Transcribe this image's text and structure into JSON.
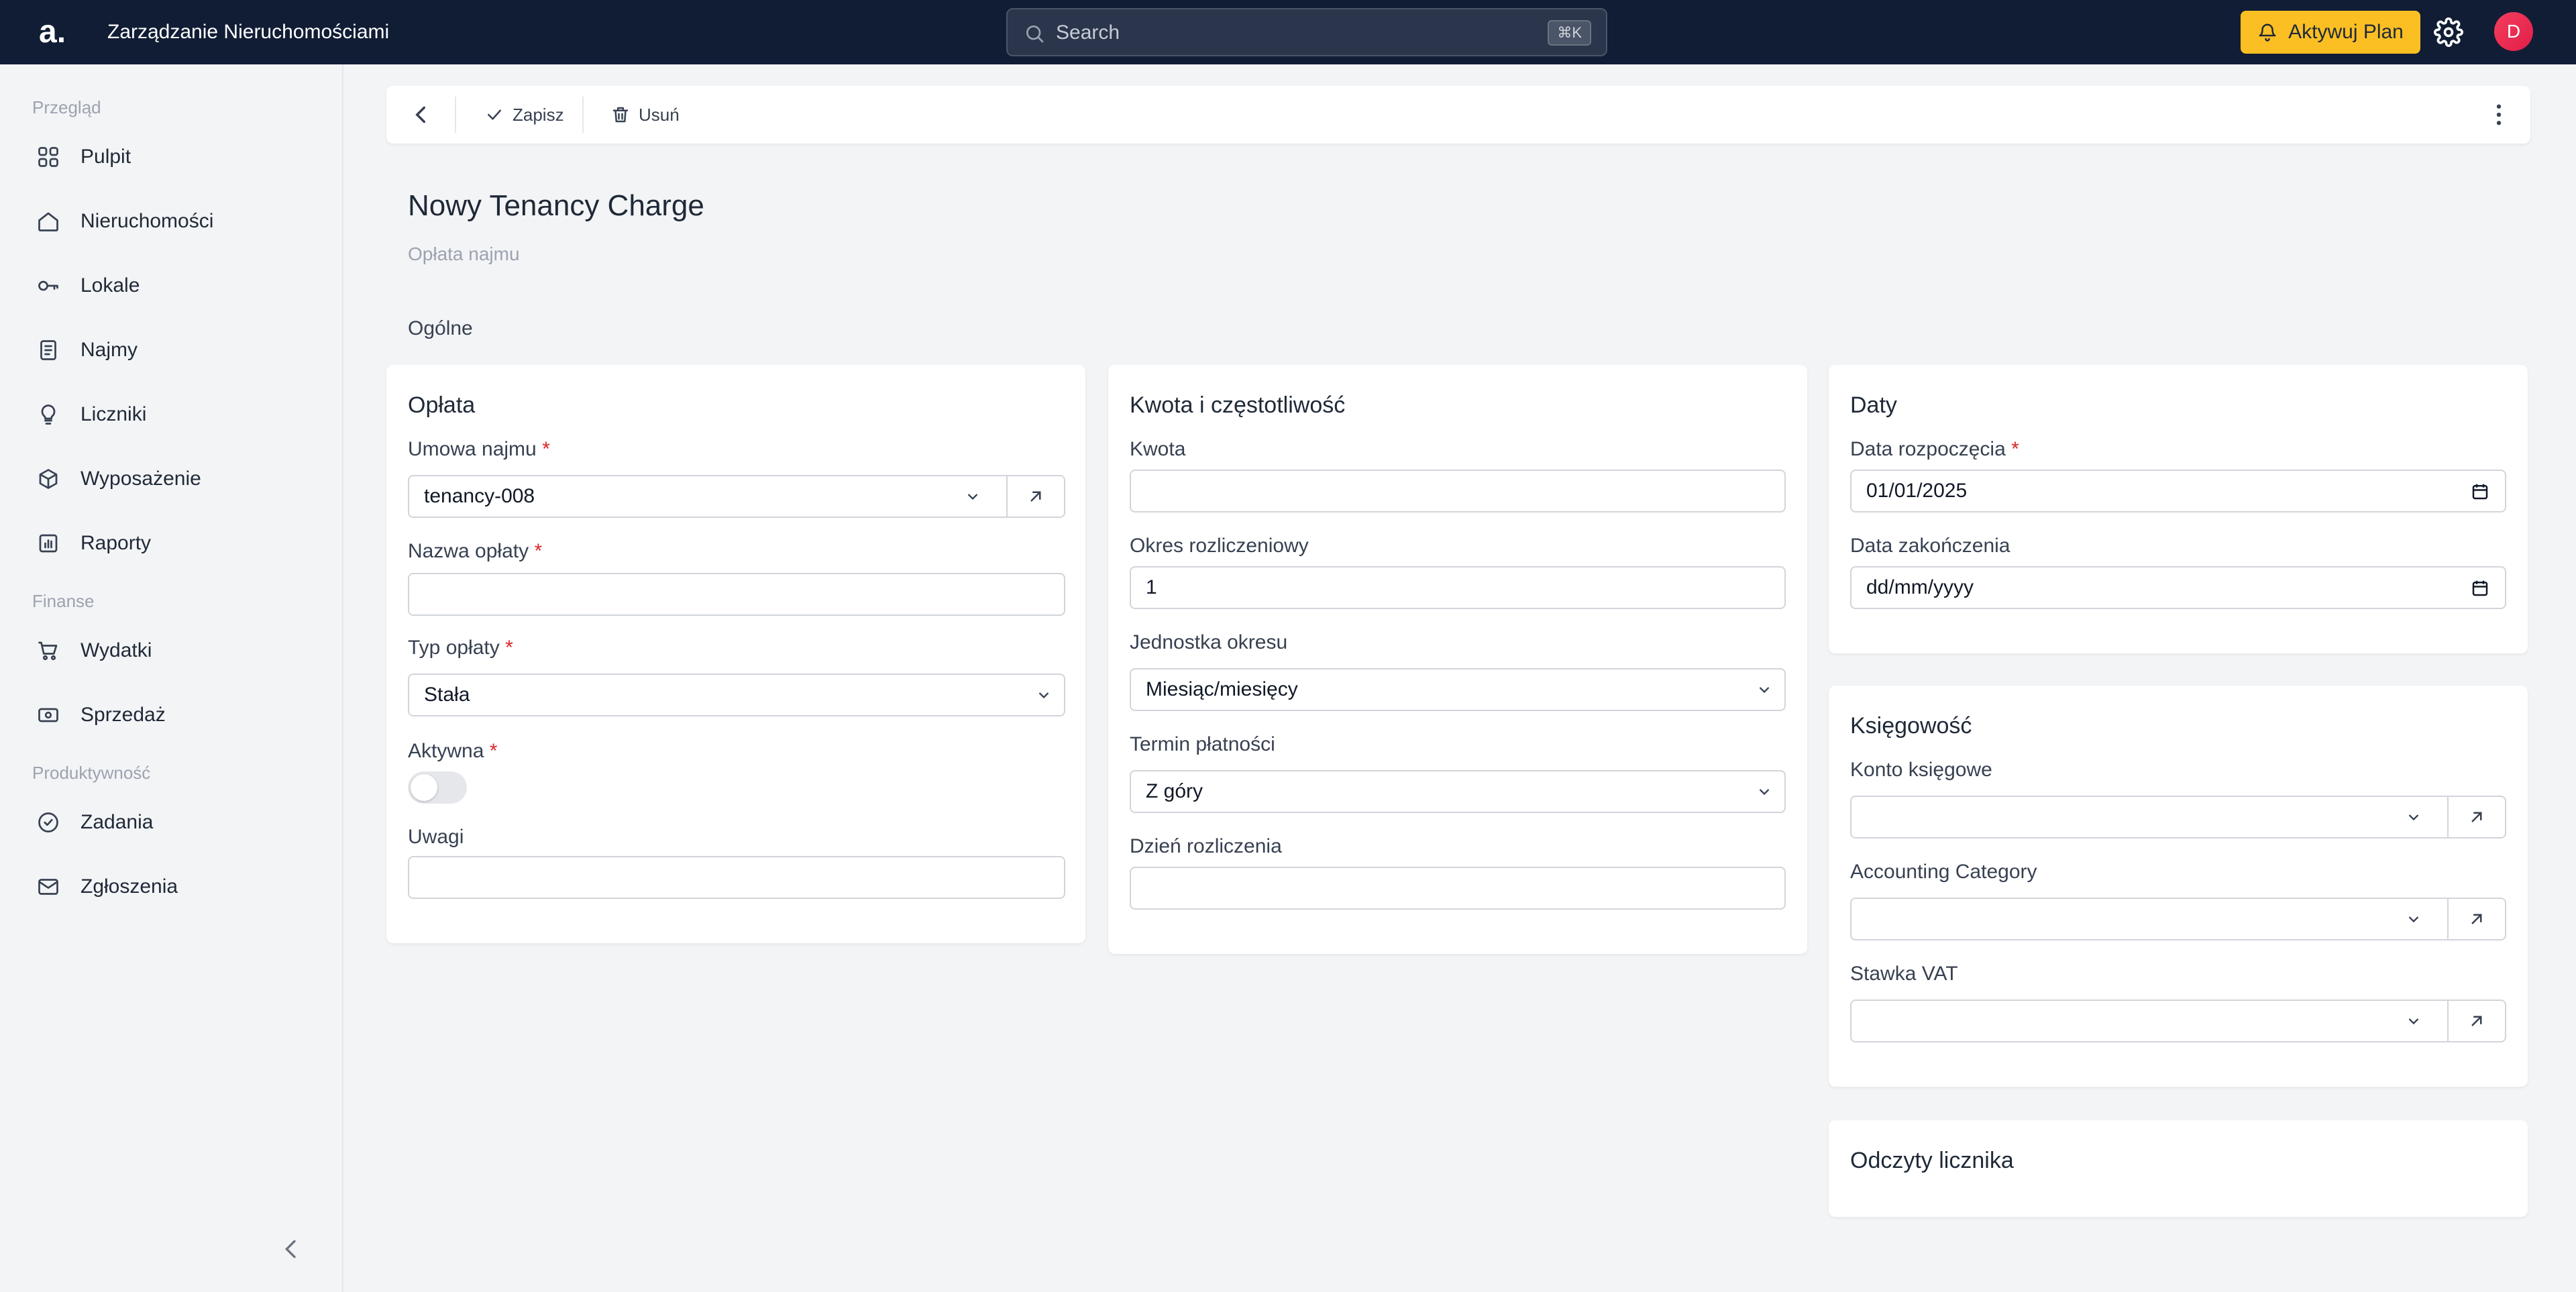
{
  "app": {
    "logo": "a.",
    "title": "Zarządzanie Nieruchomościami",
    "search_placeholder": "Search",
    "search_shortcut": "⌘K",
    "plan_label": "Aktywuj Plan",
    "avatar_letter": "D"
  },
  "sidebar": {
    "sections": [
      "Przegląd",
      "Finanse",
      "Produktywność"
    ],
    "items": [
      {
        "label": "Pulpit",
        "icon": "grid-icon"
      },
      {
        "label": "Nieruchomości",
        "icon": "house-icon"
      },
      {
        "label": "Lokale",
        "icon": "key-icon"
      },
      {
        "label": "Najmy",
        "icon": "document-icon"
      },
      {
        "label": "Liczniki",
        "icon": "lightbulb-icon"
      },
      {
        "label": "Wyposażenie",
        "icon": "box-icon"
      },
      {
        "label": "Raporty",
        "icon": "chart-icon"
      },
      {
        "label": "Wydatki",
        "icon": "cart-icon"
      },
      {
        "label": "Sprzedaż",
        "icon": "money-icon"
      },
      {
        "label": "Zadania",
        "icon": "check-circle-icon"
      },
      {
        "label": "Zgłoszenia",
        "icon": "mail-icon"
      }
    ]
  },
  "toolbar": {
    "save_label": "Zapisz",
    "delete_label": "Usuń"
  },
  "page": {
    "title": "Nowy Tenancy Charge",
    "subtitle": "Opłata najmu",
    "section": "Ogólne"
  },
  "cards": {
    "oplata": {
      "title": "Opłata",
      "tenancy_label": "Umowa najmu",
      "tenancy_value": "tenancy-008",
      "name_label": "Nazwa opłaty",
      "name_value": "",
      "type_label": "Typ opłaty",
      "type_value": "Stała",
      "active_label": "Aktywna",
      "active": false,
      "notes_label": "Uwagi",
      "notes_value": ""
    },
    "kwota": {
      "title": "Kwota i częstotliwość",
      "amount_label": "Kwota",
      "amount_value": "",
      "period_label": "Okres rozliczeniowy",
      "period_value": "1",
      "unit_label": "Jednostka okresu",
      "unit_value": "Miesiąc/miesięcy",
      "due_label": "Termin płatności",
      "due_value": "Z góry",
      "day_label": "Dzień rozliczenia",
      "day_value": ""
    },
    "daty": {
      "title": "Daty",
      "start_label": "Data rozpoczęcia",
      "start_value": "01/01/2025",
      "end_label": "Data zakończenia",
      "end_value": "dd/mm/yyyy"
    },
    "ksiegowosc": {
      "title": "Księgowość",
      "account_label": "Konto księgowe",
      "category_label": "Accounting Category",
      "vat_label": "Stawka VAT"
    },
    "odczyty": {
      "title": "Odczyty licznika"
    }
  },
  "colors": {
    "topbar": "#111d35",
    "accent": "#fbbf24",
    "required": "#dc2626"
  }
}
